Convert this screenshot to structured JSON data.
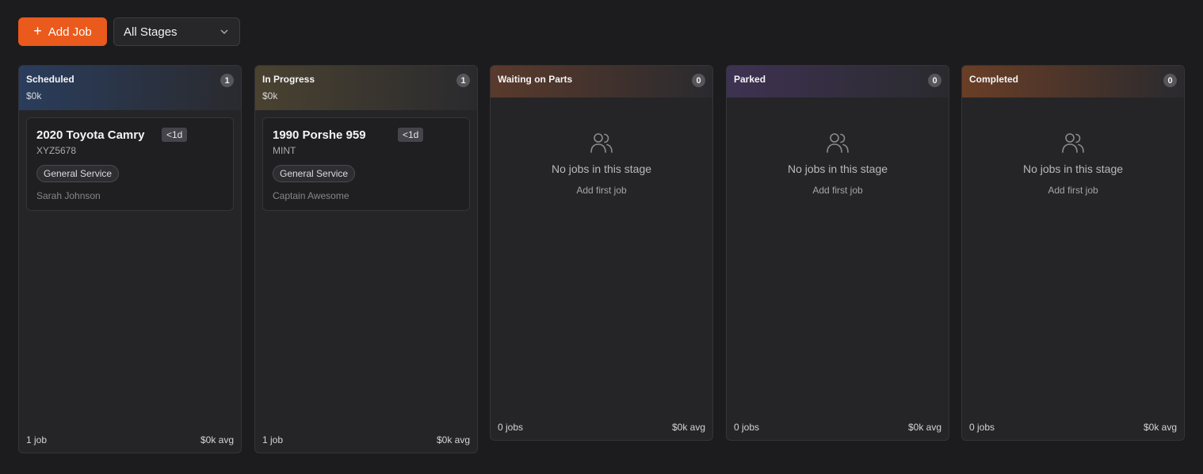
{
  "toolbar": {
    "add_label": "Add Job",
    "stage_filter": "All Stages"
  },
  "columns": [
    {
      "title": "Scheduled",
      "count": "1",
      "value": "$0k",
      "color": "#2a3d5c",
      "cards": [
        {
          "title": "2020 Toyota Camry",
          "age": "<1d",
          "plate": "XYZ5678",
          "tag": "General Service",
          "owner": "Sarah Johnson"
        }
      ],
      "footer_jobs": "1 job",
      "footer_avg": "$0k avg"
    },
    {
      "title": "In Progress",
      "count": "1",
      "value": "$0k",
      "color": "#4a4230",
      "cards": [
        {
          "title": "1990 Porshe 959",
          "age": "<1d",
          "plate": "MINT",
          "tag": "General Service",
          "owner": "Captain Awesome"
        }
      ],
      "footer_jobs": "1 job",
      "footer_avg": "$0k avg"
    },
    {
      "title": "Waiting on Parts",
      "count": "0",
      "color": "#5a3a2c",
      "empty_title": "No jobs in this stage",
      "empty_link": "Add first job",
      "footer_jobs": "0 jobs",
      "footer_avg": "$0k avg"
    },
    {
      "title": "Parked",
      "count": "0",
      "color": "#3e3252",
      "empty_title": "No jobs in this stage",
      "empty_link": "Add first job",
      "footer_jobs": "0 jobs",
      "footer_avg": "$0k avg"
    },
    {
      "title": "Completed",
      "count": "0",
      "color": "#6a3e26",
      "empty_title": "No jobs in this stage",
      "empty_link": "Add first job",
      "footer_jobs": "0 jobs",
      "footer_avg": "$0k avg"
    }
  ]
}
